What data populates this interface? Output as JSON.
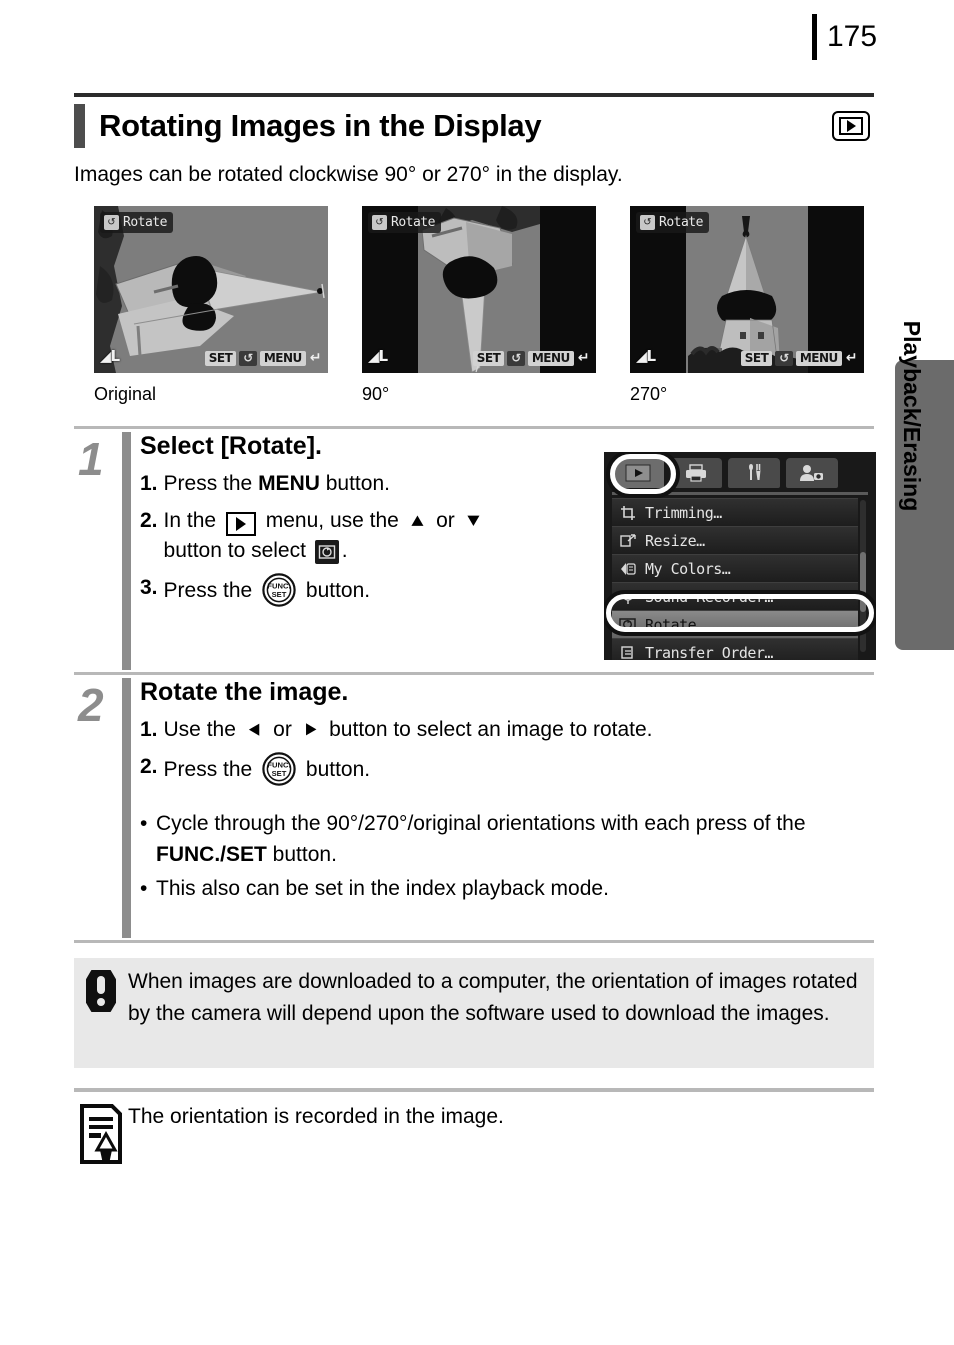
{
  "page": {
    "number": "175"
  },
  "header": {
    "title": "Rotating Images in the Display",
    "icon": "playback-icon"
  },
  "intro": "Images can be rotated clockwise 90° or 270° in the display.",
  "figures": [
    {
      "caption": "Original",
      "badge_label": "Rotate",
      "badge_icon": "rotate-icon",
      "quality_mark": "L",
      "buttons": [
        "SET",
        "rotate-icon",
        "MENU",
        "back-arrow-icon"
      ],
      "letterbox": false
    },
    {
      "caption": "90°",
      "badge_label": "Rotate",
      "badge_icon": "rotate-icon",
      "quality_mark": "L",
      "buttons": [
        "SET",
        "rotate-icon",
        "MENU",
        "back-arrow-icon"
      ],
      "letterbox": true
    },
    {
      "caption": "270°",
      "badge_label": "Rotate",
      "badge_icon": "rotate-icon",
      "quality_mark": "L",
      "buttons": [
        "SET",
        "rotate-icon",
        "MENU",
        "back-arrow-icon"
      ],
      "letterbox": true
    }
  ],
  "steps": [
    {
      "number": "1",
      "heading": "Select [Rotate].",
      "substeps": [
        {
          "n": "1.",
          "pre": "Press the ",
          "bold": "MENU",
          "post": " button."
        },
        {
          "n": "2.",
          "pre": "In the ",
          "mid": " menu, use the ",
          "mid2": " or ",
          "post": "button to select ",
          "tail": "."
        },
        {
          "n": "3.",
          "pre": "Press the ",
          "post": " button."
        }
      ]
    },
    {
      "number": "2",
      "heading": "Rotate the image.",
      "substeps": [
        {
          "n": "1.",
          "pre": "Use the ",
          "mid": " or ",
          "post": " button to select an image to rotate."
        },
        {
          "n": "2.",
          "pre": "Press the ",
          "post": " button."
        }
      ],
      "bullets": [
        {
          "pre": "Cycle through the 90°/270°/original orientations with each press of the ",
          "bold": "FUNC./SET",
          "post": " button."
        },
        {
          "pre": "This also can be set in the index playback mode.",
          "bold": "",
          "post": ""
        }
      ]
    }
  ],
  "camera_menu": {
    "tabs": [
      "playback-tab-icon",
      "print-tab-icon",
      "settings-tab-icon",
      "my-camera-tab-icon"
    ],
    "active_tab_index": 0,
    "items": [
      {
        "label": "Trimming…",
        "icon": "trimming-icon",
        "selected": false
      },
      {
        "label": "Resize…",
        "icon": "resize-icon",
        "selected": false
      },
      {
        "label": "My Colors…",
        "icon": "my-colors-icon",
        "selected": false
      },
      {
        "label": "Sound Recorder…",
        "icon": "sound-recorder-icon",
        "selected": false
      },
      {
        "label": "Rotate…",
        "icon": "rotate-icon",
        "selected": true
      },
      {
        "label": "Transfer Order…",
        "icon": "transfer-order-icon",
        "selected": false
      }
    ]
  },
  "caution": {
    "icon": "exclamation-icon",
    "text": "When images are downloaded to a computer, the orientation of images rotated by the camera will depend upon the software used to download the images."
  },
  "note": {
    "icon": "note-pencil-icon",
    "text": "The orientation is recorded in the image."
  },
  "side_tab": {
    "label": "Playback/Erasing"
  },
  "colors": {
    "side_tab_bg": "#6b6b6b",
    "caution_bg": "#e8e8e8",
    "step_accent": "#8d8d8d",
    "rule": "#b8b8b8"
  }
}
